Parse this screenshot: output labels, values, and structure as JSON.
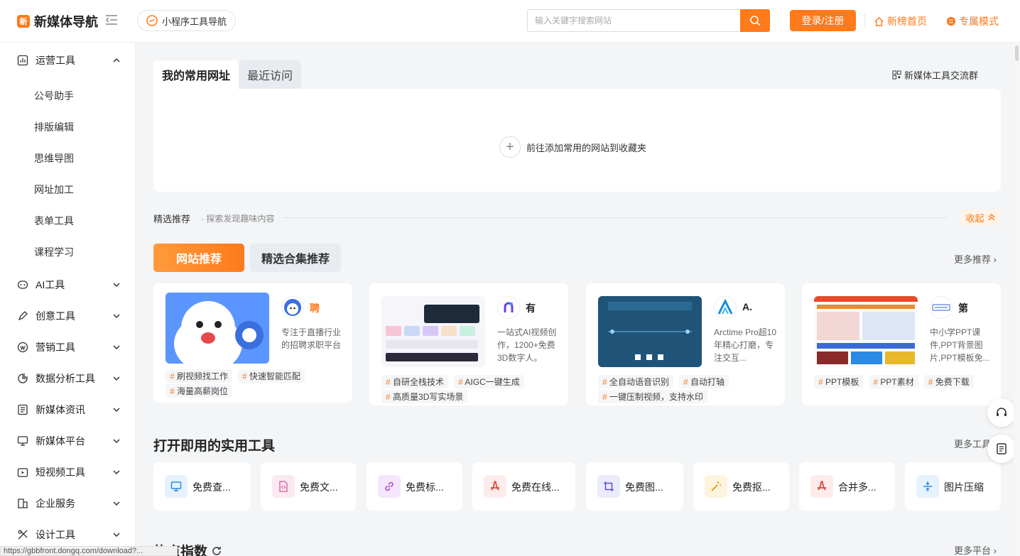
{
  "header": {
    "logo_text": "新媒体导航",
    "logo_mark": "新",
    "mini_nav_label": "小程序工具导航",
    "search_placeholder": "输入关键字搜索网站",
    "login_label": "登录/注册",
    "home_link": "新榜首页",
    "mode_link": "专属模式"
  },
  "sidebar": {
    "groups": [
      {
        "label": "运营工具",
        "icon": "chart-icon",
        "expanded": true
      },
      {
        "label": "AI工具",
        "icon": "robot-icon"
      },
      {
        "label": "创意工具",
        "icon": "pen-icon"
      },
      {
        "label": "营销工具",
        "icon": "badge-icon"
      },
      {
        "label": "数据分析工具",
        "icon": "pie-icon"
      },
      {
        "label": "新媒体资讯",
        "icon": "news-icon"
      },
      {
        "label": "新媒体平台",
        "icon": "monitor-icon"
      },
      {
        "label": "短视频工具",
        "icon": "video-icon"
      },
      {
        "label": "企业服务",
        "icon": "building-icon"
      },
      {
        "label": "设计工具",
        "icon": "design-icon"
      }
    ],
    "sub_items": [
      "公号助手",
      "排版编辑",
      "思维导图",
      "网址加工",
      "表单工具",
      "课程学习"
    ]
  },
  "favorites": {
    "tab_active": "我的常用网址",
    "tab_inactive": "最近访问",
    "group_link": "新媒体工具交流群",
    "add_text": "前往添加常用的网站到收藏夹"
  },
  "selection": {
    "title": "精选推荐",
    "subtitle": "· 探索发现趣味内容",
    "collapse_label": "收起",
    "tab_a": "网站推荐",
    "tab_b": "精选合集推荐",
    "more_label": "更多推荐 ›"
  },
  "rec_cards": [
    {
      "name": "聘",
      "desc": "专注于直播行业的招聘求职平台",
      "tags": [
        "刷视频找工作",
        "快速智能匹配",
        "海量高薪岗位"
      ],
      "accent": "#ff7a1a"
    },
    {
      "name": "有",
      "desc": "一站式AI视频创作，1200+免费3D数字人。",
      "tags": [
        "自研全栈技术",
        "AIGC一键生成",
        "高质量3D写实场景"
      ],
      "accent": "#6a3cf5"
    },
    {
      "name": "A.",
      "desc": "Arctime Pro超10年精心打磨，专注交互...",
      "tags": [
        "全自动语音识别",
        "自动打轴",
        "一键压制视频，支持水印"
      ],
      "accent": "#1a8cd8"
    },
    {
      "name": "第",
      "desc": "中小学PPT课件,PPT背景图片,PPT模板免...",
      "tags": [
        "PPT模板",
        "PPT素材",
        "免费下载"
      ],
      "accent": "#2a6acf"
    }
  ],
  "tools": {
    "title": "打开即用的实用工具",
    "more_label": "更多工具",
    "items": [
      {
        "label": "免费查...",
        "icon": "monitor-icon",
        "bg": "#e6f2fd",
        "fg": "#2a8ae6"
      },
      {
        "label": "免费文...",
        "icon": "code-file-icon",
        "bg": "#fbe9f1",
        "fg": "#d6579b"
      },
      {
        "label": "免费标...",
        "icon": "link-icon",
        "bg": "#f4e6fb",
        "fg": "#b54ad8"
      },
      {
        "label": "免费在线...",
        "icon": "pdf-icon",
        "bg": "#fdeceb",
        "fg": "#e0483c"
      },
      {
        "label": "免费图...",
        "icon": "crop-icon",
        "bg": "#ecebfb",
        "fg": "#5a4fd6"
      },
      {
        "label": "免费抠...",
        "icon": "magic-wand-icon",
        "bg": "#fdf4df",
        "fg": "#e8a317"
      },
      {
        "label": "合并多...",
        "icon": "pdf-icon",
        "bg": "#fdeceb",
        "fg": "#e0483c"
      },
      {
        "label": "图片压缩",
        "icon": "compress-icon",
        "bg": "#e6f2fd",
        "fg": "#2a8ae6"
      }
    ]
  },
  "hot": {
    "title": "热点指数",
    "more_label": "更多平台 ›"
  },
  "status_url": "https://gbbfront.dongq.com/download?..."
}
